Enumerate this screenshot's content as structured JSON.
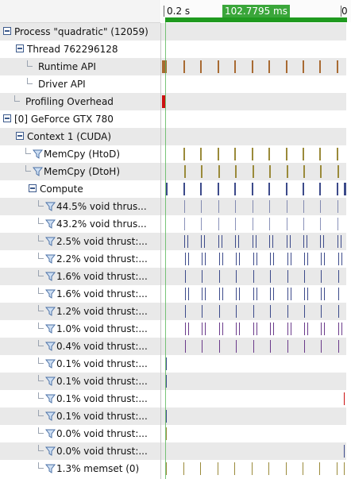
{
  "ruler": {
    "start_tick": "0.2 s",
    "range_label": "102.7795 ms",
    "end_tick": "0"
  },
  "colors": {
    "runtime": "#a86a32",
    "overhead": "#cc1111",
    "memcpy": "#9a8a3a",
    "compute": "#3c4a8a",
    "accent": "#3aa63a"
  },
  "rows": [
    {
      "label": "Process \"quadratic\" (12059)",
      "indent": 0,
      "icon": "collapse-icon",
      "shade": true
    },
    {
      "label": "Thread 762296128",
      "indent": 1,
      "icon": "collapse-icon",
      "shade": false
    },
    {
      "label": "Runtime API",
      "indent": 2,
      "icon": "tree-branch-icon",
      "shade": true
    },
    {
      "label": "Driver API",
      "indent": 2,
      "icon": "tree-branch-icon",
      "shade": false
    },
    {
      "label": "Profiling Overhead",
      "indent": 1,
      "icon": "tree-branch-icon",
      "shade": true
    },
    {
      "label": "[0] GeForce GTX 780",
      "indent": 0,
      "icon": "collapse-icon",
      "shade": false
    },
    {
      "label": "Context 1 (CUDA)",
      "indent": 1,
      "icon": "collapse-icon",
      "shade": true
    },
    {
      "label": "MemCpy (HtoD)",
      "indent": 2,
      "icon": "filter-icon",
      "shade": false
    },
    {
      "label": "MemCpy (DtoH)",
      "indent": 2,
      "icon": "filter-icon",
      "shade": true
    },
    {
      "label": "Compute",
      "indent": 2,
      "icon": "collapse-icon",
      "shade": false
    },
    {
      "label": "44.5% void thrus...",
      "indent": 3,
      "icon": "filter-icon",
      "shade": true
    },
    {
      "label": "43.2% void thrus...",
      "indent": 3,
      "icon": "filter-icon",
      "shade": false
    },
    {
      "label": "2.5% void thrust:...",
      "indent": 3,
      "icon": "filter-icon",
      "shade": true
    },
    {
      "label": "2.2% void thrust:...",
      "indent": 3,
      "icon": "filter-icon",
      "shade": false
    },
    {
      "label": "1.6% void thrust:...",
      "indent": 3,
      "icon": "filter-icon",
      "shade": true
    },
    {
      "label": "1.6% void thrust:...",
      "indent": 3,
      "icon": "filter-icon",
      "shade": false
    },
    {
      "label": "1.2% void thrust:...",
      "indent": 3,
      "icon": "filter-icon",
      "shade": true
    },
    {
      "label": "1.0% void thrust:...",
      "indent": 3,
      "icon": "filter-icon",
      "shade": false
    },
    {
      "label": "0.4% void thrust:...",
      "indent": 3,
      "icon": "filter-icon",
      "shade": true
    },
    {
      "label": "0.1% void thrust:...",
      "indent": 3,
      "icon": "filter-icon",
      "shade": false
    },
    {
      "label": "0.1% void thrust:...",
      "indent": 3,
      "icon": "filter-icon",
      "shade": true
    },
    {
      "label": "0.1% void thrust:...",
      "indent": 3,
      "icon": "filter-icon",
      "shade": false
    },
    {
      "label": "0.1% void thrust:...",
      "indent": 3,
      "icon": "filter-icon",
      "shade": true
    },
    {
      "label": "0.0% void thrust:...",
      "indent": 3,
      "icon": "filter-icon",
      "shade": false
    },
    {
      "label": "0.0% void thrust:...",
      "indent": 3,
      "icon": "filter-icon",
      "shade": true
    },
    {
      "label": "1.3% memset (0)",
      "indent": 3,
      "icon": "filter-icon",
      "shade": false
    }
  ]
}
